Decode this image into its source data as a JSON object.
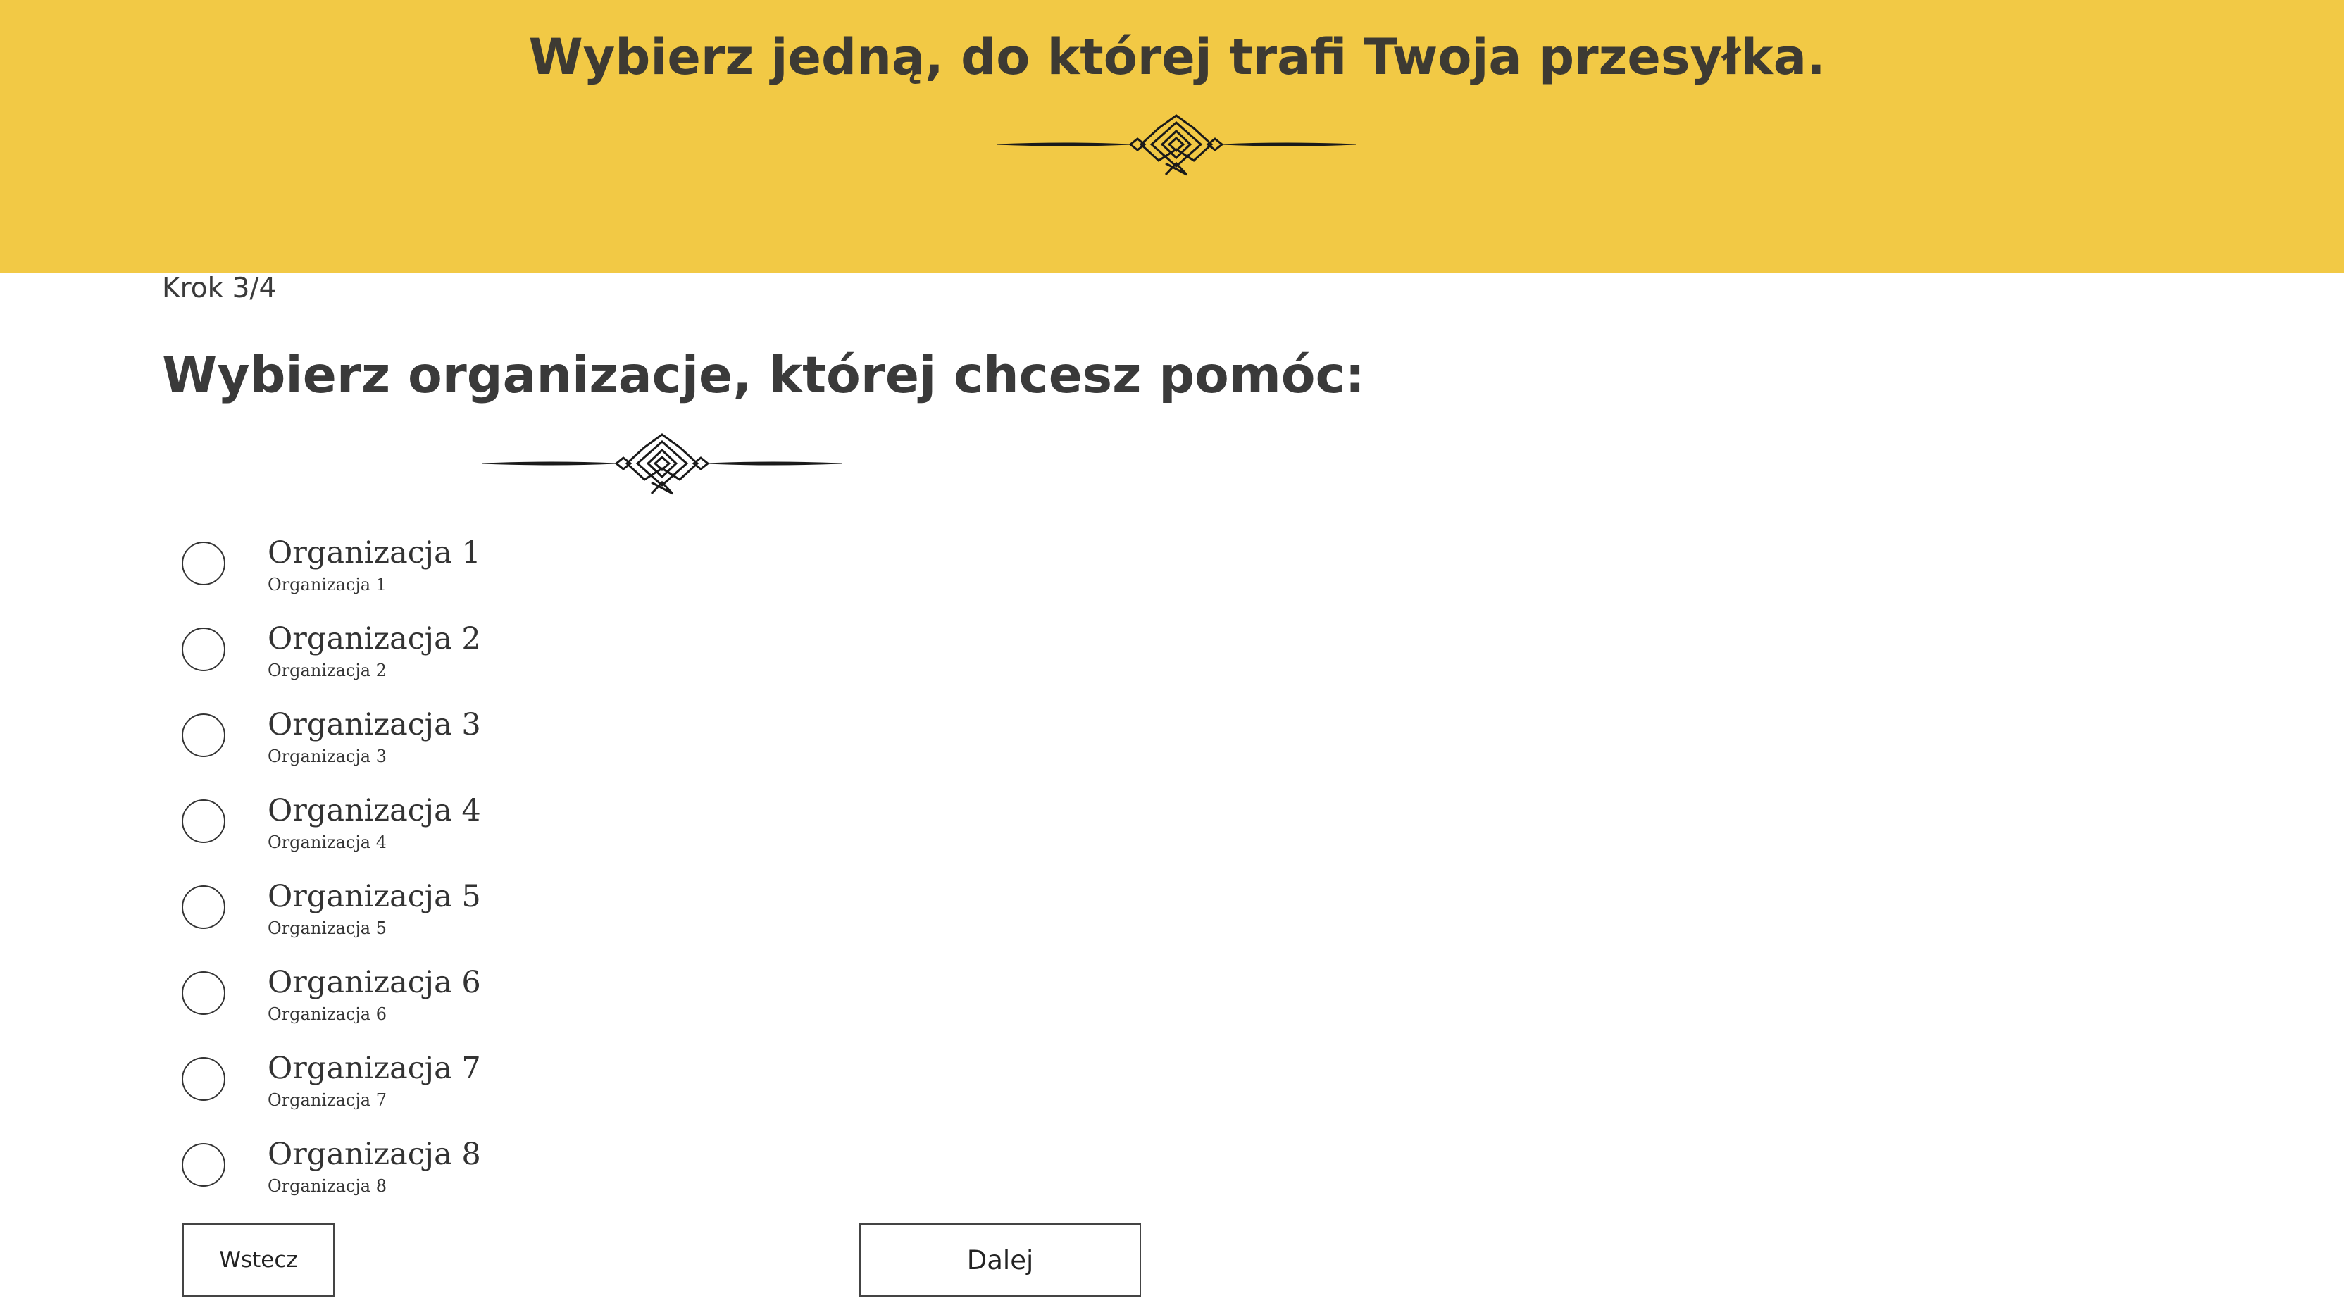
{
  "banner": {
    "title": "Wybierz jedną, do której trafi Twoja przesyłka.",
    "ornament_icon": "decorative-divider-ornament",
    "background_color": "#f2c945"
  },
  "form": {
    "step": "Krok 3/4",
    "title": "Wybierz organizacje, której chcesz pomóc:",
    "options": [
      {
        "title": "Organizacja 1",
        "subtitle": "Organizacja 1"
      },
      {
        "title": "Organizacja 2",
        "subtitle": "Organizacja 2"
      },
      {
        "title": "Organizacja 3",
        "subtitle": "Organizacja 3"
      },
      {
        "title": "Organizacja 4",
        "subtitle": "Organizacja 4"
      },
      {
        "title": "Organizacja 5",
        "subtitle": "Organizacja 5"
      },
      {
        "title": "Organizacja 6",
        "subtitle": "Organizacja 6"
      },
      {
        "title": "Organizacja 7",
        "subtitle": "Organizacja 7"
      },
      {
        "title": "Organizacja 8",
        "subtitle": "Organizacja 8"
      }
    ],
    "back_label": "Wstecz",
    "next_label": "Dalej"
  }
}
